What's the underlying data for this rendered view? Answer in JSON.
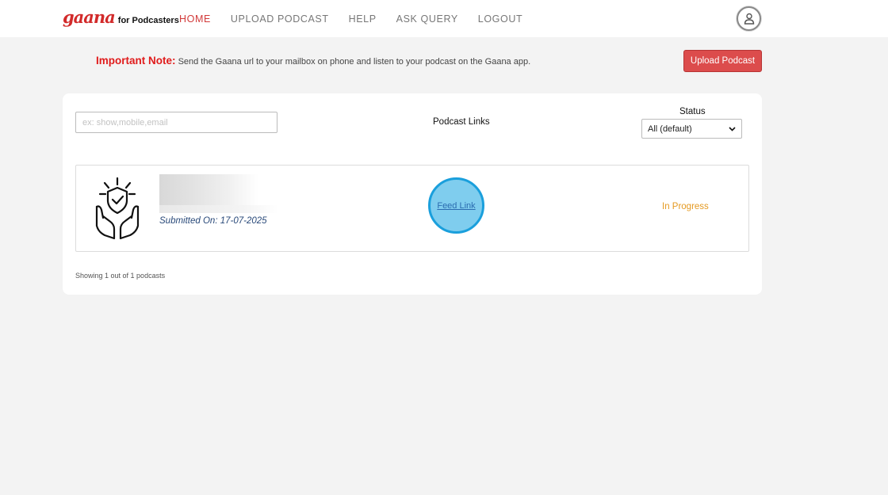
{
  "brand": {
    "logo": "gaana",
    "subtitle": "for Podcasters"
  },
  "nav": [
    {
      "label": "HOME",
      "active": true
    },
    {
      "label": "UPLOAD PODCAST",
      "active": false
    },
    {
      "label": "HELP",
      "active": false
    },
    {
      "label": "ASK QUERY",
      "active": false
    },
    {
      "label": "LOGOUT",
      "active": false
    }
  ],
  "user": {
    "icon": "user-icon"
  },
  "note": {
    "label": "Important Note:",
    "text": "Send the Gaana url to your mailbox on phone and listen to your podcast on the Gaana app."
  },
  "upload_button": "Upload Podcast",
  "filters": {
    "search_placeholder": "ex: show,mobile,email",
    "links_header": "Podcast Links",
    "status_label": "Status",
    "status_selected": "All (default)"
  },
  "podcasts": [
    {
      "icon": "shield-hands-icon",
      "submitted": "Submitted On: 17-07-2025",
      "feed_link": "Feed Link",
      "status": "In Progress"
    }
  ],
  "summary": "Showing 1 out of 1 podcasts",
  "colors": {
    "brand": "#d22a2a",
    "button": "#dc4c4c",
    "status_in_progress": "#e59a22",
    "highlight": "#7fcdee"
  }
}
